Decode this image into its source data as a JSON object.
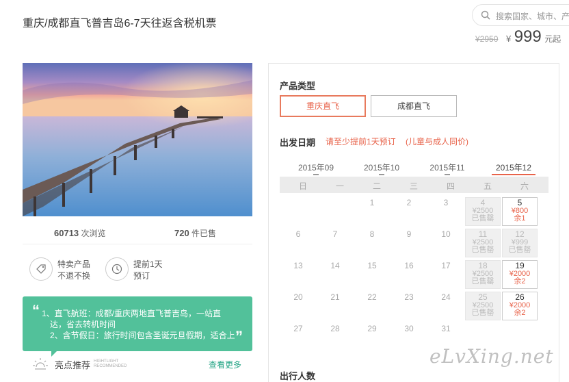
{
  "header": {
    "title": "重庆/成都直飞普吉岛6-7天往返含税机票",
    "search_placeholder": "搜索国家、城市、产",
    "price_original": "¥2950",
    "price_currency": "¥",
    "price_value": "999",
    "price_suffix": "元起"
  },
  "stats": {
    "views_count": "60713",
    "views_label": " 次浏览",
    "sold_count": "720",
    "sold_label": " 件已售"
  },
  "features": [
    {
      "line1": "特卖产品",
      "line2": "不退不换"
    },
    {
      "line1": "提前1天",
      "line2": "预订"
    }
  ],
  "highlight": {
    "open_quote": "“",
    "close_quote": "”",
    "lines": [
      "1、直飞航班：成都/重庆两地直飞普吉岛，一站直",
      "达，省去转机时间",
      "2、含节假日：旅行时间包含圣诞元旦假期，适合上"
    ],
    "label": "亮点推荐",
    "label_en_1": "HIGHTLIGHT",
    "label_en_2": "RECOMMENDED",
    "more": "查看更多"
  },
  "booking": {
    "product_type_title": "产品类型",
    "product_types": [
      "重庆直飞",
      "成都直飞"
    ],
    "selected_type": "重庆直飞",
    "departure_title": "出发日期",
    "note_1": "请至少提前1天预订",
    "note_2": "(儿童与成人同价)",
    "months": [
      "2015年09",
      "2015年10",
      "2015年11",
      "2015年12"
    ],
    "selected_month": "2015年12",
    "weekdays": [
      "日",
      "一",
      "二",
      "三",
      "四",
      "五",
      "六"
    ],
    "plain_days": [
      "1",
      "2",
      "3",
      "6",
      "7",
      "8",
      "9",
      "10",
      "13",
      "14",
      "15",
      "16",
      "17",
      "20",
      "21",
      "22",
      "23",
      "24",
      "27",
      "28",
      "29",
      "30",
      "31"
    ],
    "priced_days": [
      {
        "day": "4",
        "price": "¥2500",
        "status": "已售罄",
        "state": "sold"
      },
      {
        "day": "5",
        "price": "¥800",
        "status": "余1",
        "state": "available"
      },
      {
        "day": "11",
        "price": "¥2500",
        "status": "已售罄",
        "state": "sold"
      },
      {
        "day": "12",
        "price": "¥999",
        "status": "已售罄",
        "state": "sold"
      },
      {
        "day": "18",
        "price": "¥2500",
        "status": "已售罄",
        "state": "sold"
      },
      {
        "day": "19",
        "price": "¥2000",
        "status": "余2",
        "state": "available"
      },
      {
        "day": "25",
        "price": "¥2500",
        "status": "已售罄",
        "state": "sold"
      },
      {
        "day": "26",
        "price": "¥2000",
        "status": "余2",
        "state": "available"
      }
    ],
    "travelers_title": "出行人数"
  },
  "watermark": "eLvXing.net",
  "colors": {
    "accent": "#e8634a",
    "green": "#52c19a",
    "link_green": "#25a586"
  },
  "icons": [
    "search-icon",
    "tag-icon",
    "clock-icon",
    "sun-icon"
  ]
}
